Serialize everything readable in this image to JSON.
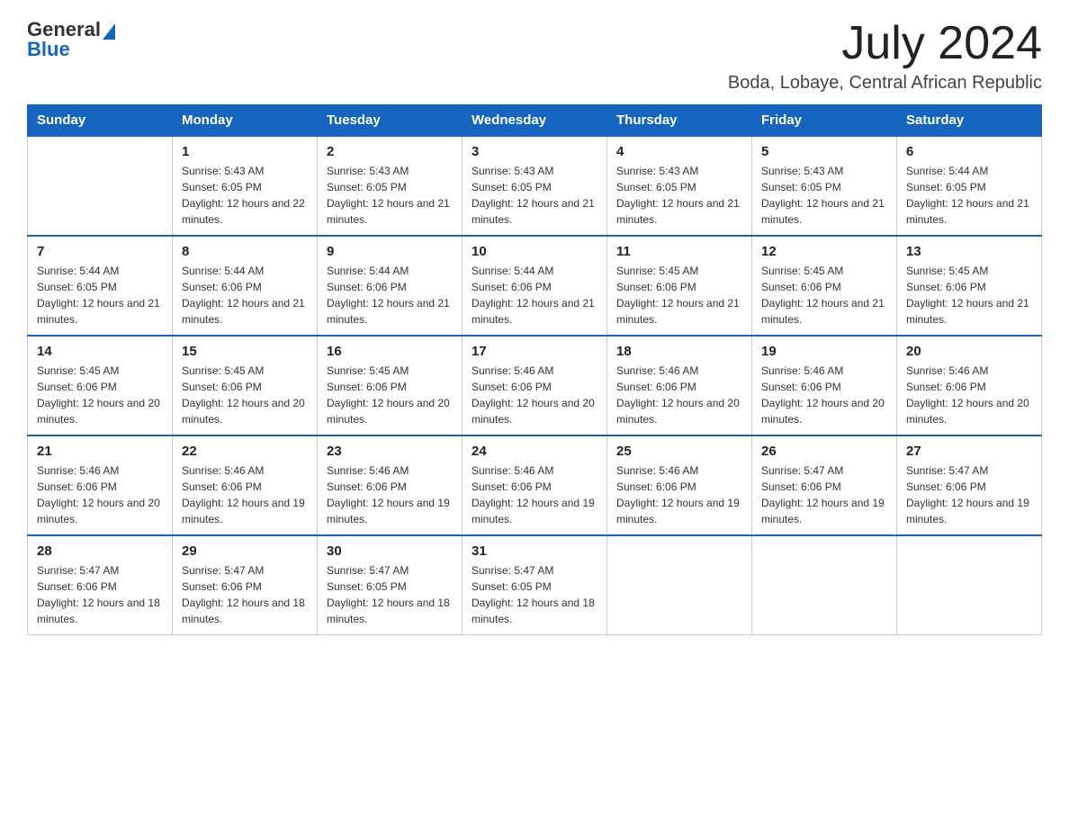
{
  "header": {
    "logo_general": "General",
    "logo_blue": "Blue",
    "month_year": "July 2024",
    "location": "Boda, Lobaye, Central African Republic"
  },
  "weekdays": [
    "Sunday",
    "Monday",
    "Tuesday",
    "Wednesday",
    "Thursday",
    "Friday",
    "Saturday"
  ],
  "weeks": [
    [
      {
        "day": "",
        "sunrise": "",
        "sunset": "",
        "daylight": ""
      },
      {
        "day": "1",
        "sunrise": "Sunrise: 5:43 AM",
        "sunset": "Sunset: 6:05 PM",
        "daylight": "Daylight: 12 hours and 22 minutes."
      },
      {
        "day": "2",
        "sunrise": "Sunrise: 5:43 AM",
        "sunset": "Sunset: 6:05 PM",
        "daylight": "Daylight: 12 hours and 21 minutes."
      },
      {
        "day": "3",
        "sunrise": "Sunrise: 5:43 AM",
        "sunset": "Sunset: 6:05 PM",
        "daylight": "Daylight: 12 hours and 21 minutes."
      },
      {
        "day": "4",
        "sunrise": "Sunrise: 5:43 AM",
        "sunset": "Sunset: 6:05 PM",
        "daylight": "Daylight: 12 hours and 21 minutes."
      },
      {
        "day": "5",
        "sunrise": "Sunrise: 5:43 AM",
        "sunset": "Sunset: 6:05 PM",
        "daylight": "Daylight: 12 hours and 21 minutes."
      },
      {
        "day": "6",
        "sunrise": "Sunrise: 5:44 AM",
        "sunset": "Sunset: 6:05 PM",
        "daylight": "Daylight: 12 hours and 21 minutes."
      }
    ],
    [
      {
        "day": "7",
        "sunrise": "Sunrise: 5:44 AM",
        "sunset": "Sunset: 6:05 PM",
        "daylight": "Daylight: 12 hours and 21 minutes."
      },
      {
        "day": "8",
        "sunrise": "Sunrise: 5:44 AM",
        "sunset": "Sunset: 6:06 PM",
        "daylight": "Daylight: 12 hours and 21 minutes."
      },
      {
        "day": "9",
        "sunrise": "Sunrise: 5:44 AM",
        "sunset": "Sunset: 6:06 PM",
        "daylight": "Daylight: 12 hours and 21 minutes."
      },
      {
        "day": "10",
        "sunrise": "Sunrise: 5:44 AM",
        "sunset": "Sunset: 6:06 PM",
        "daylight": "Daylight: 12 hours and 21 minutes."
      },
      {
        "day": "11",
        "sunrise": "Sunrise: 5:45 AM",
        "sunset": "Sunset: 6:06 PM",
        "daylight": "Daylight: 12 hours and 21 minutes."
      },
      {
        "day": "12",
        "sunrise": "Sunrise: 5:45 AM",
        "sunset": "Sunset: 6:06 PM",
        "daylight": "Daylight: 12 hours and 21 minutes."
      },
      {
        "day": "13",
        "sunrise": "Sunrise: 5:45 AM",
        "sunset": "Sunset: 6:06 PM",
        "daylight": "Daylight: 12 hours and 21 minutes."
      }
    ],
    [
      {
        "day": "14",
        "sunrise": "Sunrise: 5:45 AM",
        "sunset": "Sunset: 6:06 PM",
        "daylight": "Daylight: 12 hours and 20 minutes."
      },
      {
        "day": "15",
        "sunrise": "Sunrise: 5:45 AM",
        "sunset": "Sunset: 6:06 PM",
        "daylight": "Daylight: 12 hours and 20 minutes."
      },
      {
        "day": "16",
        "sunrise": "Sunrise: 5:45 AM",
        "sunset": "Sunset: 6:06 PM",
        "daylight": "Daylight: 12 hours and 20 minutes."
      },
      {
        "day": "17",
        "sunrise": "Sunrise: 5:46 AM",
        "sunset": "Sunset: 6:06 PM",
        "daylight": "Daylight: 12 hours and 20 minutes."
      },
      {
        "day": "18",
        "sunrise": "Sunrise: 5:46 AM",
        "sunset": "Sunset: 6:06 PM",
        "daylight": "Daylight: 12 hours and 20 minutes."
      },
      {
        "day": "19",
        "sunrise": "Sunrise: 5:46 AM",
        "sunset": "Sunset: 6:06 PM",
        "daylight": "Daylight: 12 hours and 20 minutes."
      },
      {
        "day": "20",
        "sunrise": "Sunrise: 5:46 AM",
        "sunset": "Sunset: 6:06 PM",
        "daylight": "Daylight: 12 hours and 20 minutes."
      }
    ],
    [
      {
        "day": "21",
        "sunrise": "Sunrise: 5:46 AM",
        "sunset": "Sunset: 6:06 PM",
        "daylight": "Daylight: 12 hours and 20 minutes."
      },
      {
        "day": "22",
        "sunrise": "Sunrise: 5:46 AM",
        "sunset": "Sunset: 6:06 PM",
        "daylight": "Daylight: 12 hours and 19 minutes."
      },
      {
        "day": "23",
        "sunrise": "Sunrise: 5:46 AM",
        "sunset": "Sunset: 6:06 PM",
        "daylight": "Daylight: 12 hours and 19 minutes."
      },
      {
        "day": "24",
        "sunrise": "Sunrise: 5:46 AM",
        "sunset": "Sunset: 6:06 PM",
        "daylight": "Daylight: 12 hours and 19 minutes."
      },
      {
        "day": "25",
        "sunrise": "Sunrise: 5:46 AM",
        "sunset": "Sunset: 6:06 PM",
        "daylight": "Daylight: 12 hours and 19 minutes."
      },
      {
        "day": "26",
        "sunrise": "Sunrise: 5:47 AM",
        "sunset": "Sunset: 6:06 PM",
        "daylight": "Daylight: 12 hours and 19 minutes."
      },
      {
        "day": "27",
        "sunrise": "Sunrise: 5:47 AM",
        "sunset": "Sunset: 6:06 PM",
        "daylight": "Daylight: 12 hours and 19 minutes."
      }
    ],
    [
      {
        "day": "28",
        "sunrise": "Sunrise: 5:47 AM",
        "sunset": "Sunset: 6:06 PM",
        "daylight": "Daylight: 12 hours and 18 minutes."
      },
      {
        "day": "29",
        "sunrise": "Sunrise: 5:47 AM",
        "sunset": "Sunset: 6:06 PM",
        "daylight": "Daylight: 12 hours and 18 minutes."
      },
      {
        "day": "30",
        "sunrise": "Sunrise: 5:47 AM",
        "sunset": "Sunset: 6:05 PM",
        "daylight": "Daylight: 12 hours and 18 minutes."
      },
      {
        "day": "31",
        "sunrise": "Sunrise: 5:47 AM",
        "sunset": "Sunset: 6:05 PM",
        "daylight": "Daylight: 12 hours and 18 minutes."
      },
      {
        "day": "",
        "sunrise": "",
        "sunset": "",
        "daylight": ""
      },
      {
        "day": "",
        "sunrise": "",
        "sunset": "",
        "daylight": ""
      },
      {
        "day": "",
        "sunrise": "",
        "sunset": "",
        "daylight": ""
      }
    ]
  ]
}
